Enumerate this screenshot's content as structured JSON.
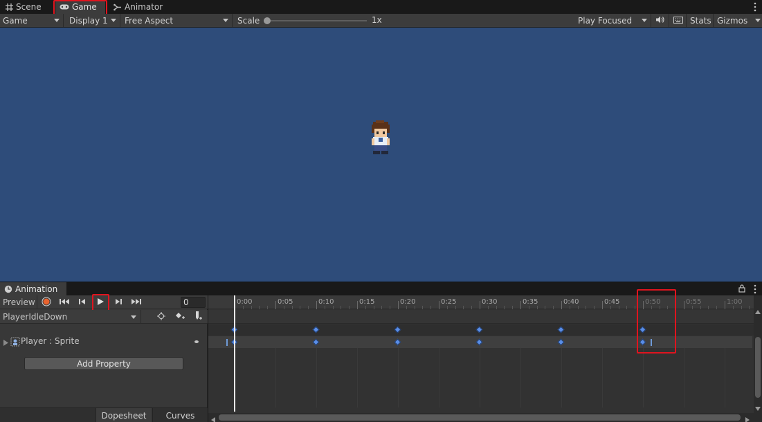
{
  "tabs": [
    {
      "label": "Scene",
      "icon": "grid-icon"
    },
    {
      "label": "Game",
      "icon": "gamepad-icon",
      "active": true
    },
    {
      "label": "Animator",
      "icon": "animator-icon"
    }
  ],
  "game_toolbar": {
    "view_mode": "Game",
    "display": "Display 1",
    "aspect": "Free Aspect",
    "scale_label": "Scale",
    "scale_value": "1x",
    "play_mode": "Play Focused",
    "stats": "Stats",
    "gizmos": "Gizmos"
  },
  "animation": {
    "window_title": "Animation",
    "preview_label": "Preview",
    "frame_value": "0",
    "clip_name": "PlayerIdleDown",
    "property_label": "Player : Sprite",
    "add_property_label": "Add Property",
    "dopesheet_label": "Dopesheet",
    "curves_label": "Curves",
    "timeline_labels": [
      "0:00",
      "0:05",
      "0:10",
      "0:15",
      "0:20",
      "0:25",
      "0:30",
      "0:35",
      "0:40",
      "0:45",
      "0:50",
      "0:55",
      "1:00"
    ],
    "keyframe_times": [
      "0:00",
      "0:10",
      "0:20",
      "0:30",
      "0:40",
      "0:50"
    ]
  },
  "colors": {
    "highlight": "#e0141e",
    "game_background": "#2e4c7a",
    "keyframe": "#5b8ee6",
    "record_button": "#e8632f"
  }
}
